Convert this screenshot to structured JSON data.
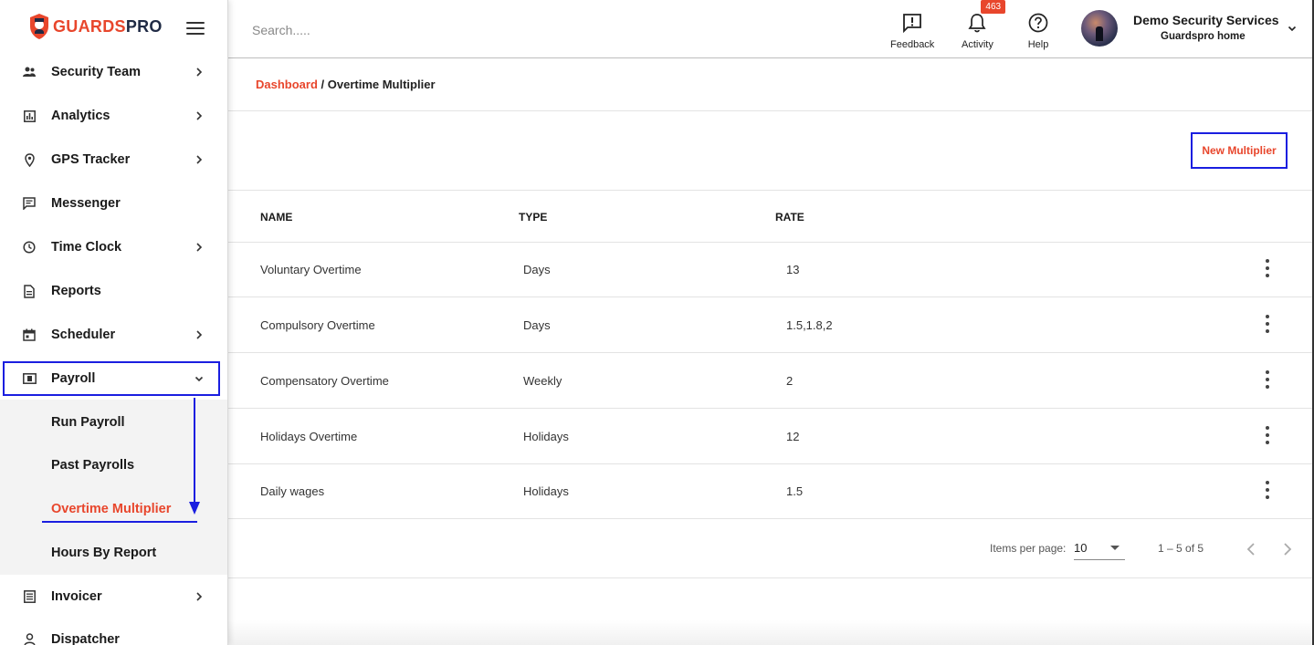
{
  "brand": {
    "part1": "GUARDS",
    "part2": "PRO"
  },
  "search": {
    "placeholder": "Search....."
  },
  "topbar": {
    "feedback_label": "Feedback",
    "activity_label": "Activity",
    "activity_badge": "463",
    "help_label": "Help",
    "user_name": "Demo Security Services",
    "user_org": "Guardspro home"
  },
  "sidebar": {
    "items": [
      {
        "label": "Security Team",
        "icon": "people-icon"
      },
      {
        "label": "Analytics",
        "icon": "bar-chart-icon"
      },
      {
        "label": "GPS Tracker",
        "icon": "location-pin-icon"
      },
      {
        "label": "Messenger",
        "icon": "chat-icon"
      },
      {
        "label": "Time Clock",
        "icon": "clock-icon"
      },
      {
        "label": "Reports",
        "icon": "document-icon"
      },
      {
        "label": "Scheduler",
        "icon": "calendar-icon"
      },
      {
        "label": "Payroll",
        "icon": "money-icon"
      },
      {
        "label": "Invoicer",
        "icon": "list-icon"
      },
      {
        "label": "Dispatcher",
        "icon": "person-icon"
      }
    ],
    "payroll_sub": [
      {
        "label": "Run Payroll"
      },
      {
        "label": "Past Payrolls"
      },
      {
        "label": "Overtime Multiplier"
      },
      {
        "label": "Hours By Report"
      }
    ]
  },
  "breadcrumb": {
    "root": "Dashboard",
    "separator": " / ",
    "current": "Overtime Multiplier"
  },
  "actions": {
    "new_multiplier": "New Multiplier"
  },
  "table": {
    "headers": {
      "name": "NAME",
      "type": "TYPE",
      "rate": "RATE"
    },
    "rows": [
      {
        "name": "Voluntary Overtime",
        "type": "Days",
        "rate": "13"
      },
      {
        "name": "Compulsory Overtime",
        "type": "Days",
        "rate": "1.5,1.8,2"
      },
      {
        "name": "Compensatory Overtime",
        "type": "Weekly",
        "rate": "2"
      },
      {
        "name": "Holidays Overtime",
        "type": "Holidays",
        "rate": "12"
      },
      {
        "name": "Daily wages",
        "type": "Holidays",
        "rate": "1.5"
      }
    ]
  },
  "pagination": {
    "items_per_page_label": "Items per page:",
    "page_size": "10",
    "range": "1 – 5 of 5"
  },
  "colors": {
    "accent": "#e8462c",
    "annotation": "#1a1ee0",
    "brand_dark": "#1f2a44"
  }
}
